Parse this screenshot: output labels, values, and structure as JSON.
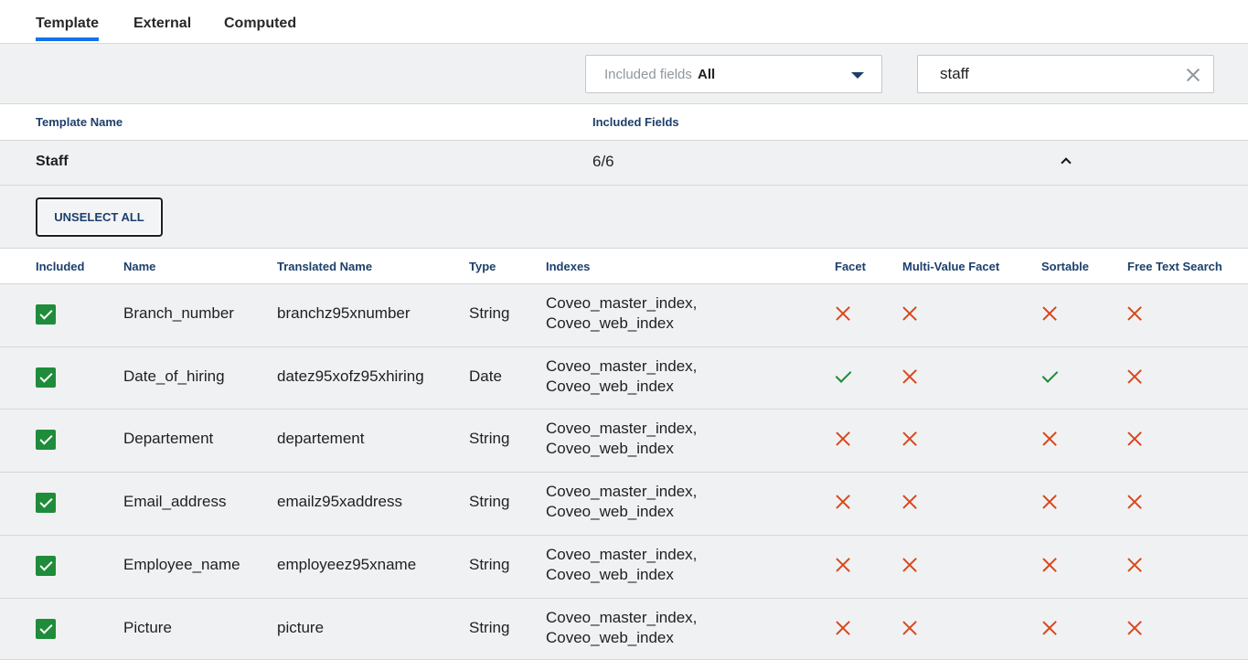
{
  "tabs": [
    {
      "label": "Template",
      "active": true
    },
    {
      "label": "External",
      "active": false
    },
    {
      "label": "Computed",
      "active": false
    }
  ],
  "filters": {
    "included_fields_label": "Included fields",
    "included_fields_value": "All",
    "search_value": "staff"
  },
  "template_table": {
    "col_name": "Template Name",
    "col_included": "Included Fields",
    "rows": [
      {
        "name": "Staff",
        "included": "6/6"
      }
    ]
  },
  "actions": {
    "unselect_all": "UNSELECT ALL"
  },
  "fields_table": {
    "headers": {
      "included": "Included",
      "name": "Name",
      "translated_name": "Translated Name",
      "type": "Type",
      "indexes": "Indexes",
      "facet": "Facet",
      "multi_value_facet": "Multi-Value Facet",
      "sortable": "Sortable",
      "free_text_search": "Free Text Search"
    },
    "rows": [
      {
        "included": true,
        "name": "Branch_number",
        "translated_name": "branchz95xnumber",
        "type": "String",
        "index_1": "Coveo_master_index,",
        "index_2": "Coveo_web_index",
        "facet": false,
        "multi_value_facet": false,
        "sortable": false,
        "free_text_search": false
      },
      {
        "included": true,
        "name": "Date_of_hiring",
        "translated_name": "datez95xofz95xhiring",
        "type": "Date",
        "index_1": "Coveo_master_index,",
        "index_2": "Coveo_web_index",
        "facet": true,
        "multi_value_facet": false,
        "sortable": true,
        "free_text_search": false
      },
      {
        "included": true,
        "name": "Departement",
        "translated_name": "departement",
        "type": "String",
        "index_1": "Coveo_master_index,",
        "index_2": "Coveo_web_index",
        "facet": false,
        "multi_value_facet": false,
        "sortable": false,
        "free_text_search": false
      },
      {
        "included": true,
        "name": "Email_address",
        "translated_name": "emailz95xaddress",
        "type": "String",
        "index_1": "Coveo_master_index,",
        "index_2": "Coveo_web_index",
        "facet": false,
        "multi_value_facet": false,
        "sortable": false,
        "free_text_search": false
      },
      {
        "included": true,
        "name": "Employee_name",
        "translated_name": "employeez95xname",
        "type": "String",
        "index_1": "Coveo_master_index,",
        "index_2": "Coveo_web_index",
        "facet": false,
        "multi_value_facet": false,
        "sortable": false,
        "free_text_search": false
      },
      {
        "included": true,
        "name": "Picture",
        "translated_name": "picture",
        "type": "String",
        "index_1": "Coveo_master_index,",
        "index_2": "Coveo_web_index",
        "facet": false,
        "multi_value_facet": false,
        "sortable": false,
        "free_text_search": false
      }
    ]
  },
  "colors": {
    "accent": "#1372ec",
    "success": "#1e8c3a",
    "danger": "#d9471c",
    "header_text": "#1d3f6b"
  }
}
